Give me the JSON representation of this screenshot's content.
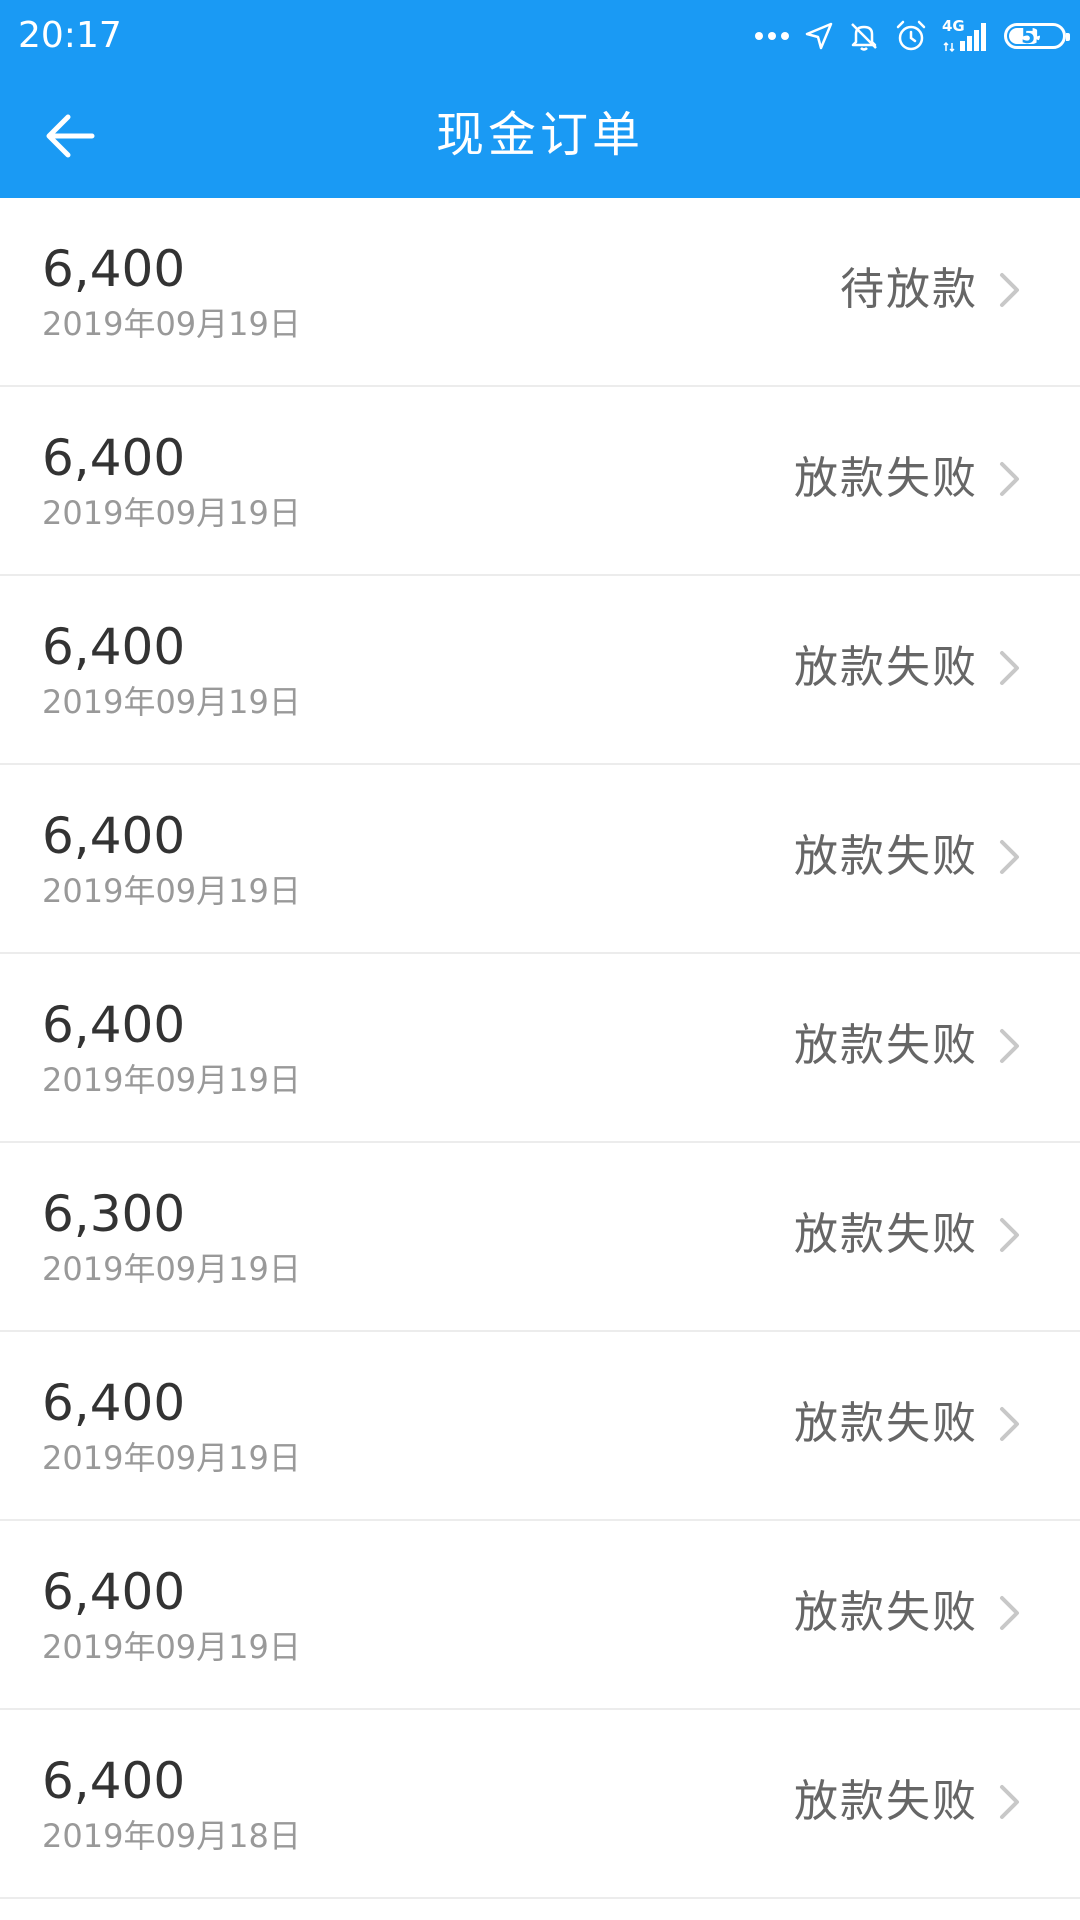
{
  "status_bar": {
    "time": "20:17",
    "network": "4G",
    "battery": "55",
    "icons": [
      "more-dots-icon",
      "location-arrow-icon",
      "bell-off-icon",
      "alarm-clock-icon",
      "signal-icon",
      "battery-icon"
    ]
  },
  "app_bar": {
    "title": "现金订单",
    "back_icon": "arrow-left-icon"
  },
  "colors": {
    "primary": "#1a9af4",
    "amount_text": "#333333",
    "date_text": "#999999",
    "status_text": "#666666",
    "divider": "#ececec"
  },
  "orders": [
    {
      "amount": "6,400",
      "date": "2019年09月19日",
      "status": "待放款"
    },
    {
      "amount": "6,400",
      "date": "2019年09月19日",
      "status": "放款失败"
    },
    {
      "amount": "6,400",
      "date": "2019年09月19日",
      "status": "放款失败"
    },
    {
      "amount": "6,400",
      "date": "2019年09月19日",
      "status": "放款失败"
    },
    {
      "amount": "6,400",
      "date": "2019年09月19日",
      "status": "放款失败"
    },
    {
      "amount": "6,300",
      "date": "2019年09月19日",
      "status": "放款失败"
    },
    {
      "amount": "6,400",
      "date": "2019年09月19日",
      "status": "放款失败"
    },
    {
      "amount": "6,400",
      "date": "2019年09月19日",
      "status": "放款失败"
    },
    {
      "amount": "6,400",
      "date": "2019年09月18日",
      "status": "放款失败"
    }
  ]
}
